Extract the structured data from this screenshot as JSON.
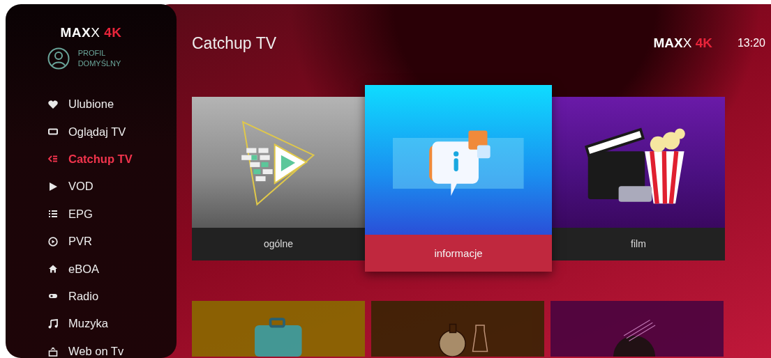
{
  "sidebar": {
    "logo": [
      {
        "text": "MAX",
        "kind": "bold"
      },
      {
        "text": "X",
        "kind": "light"
      },
      {
        "text": " 4K",
        "kind": "accent"
      }
    ],
    "profile": {
      "line1": "PROFIL",
      "line2": "DOMYŚLNY"
    },
    "items": [
      {
        "label": "Ulubione",
        "kind": "heart",
        "selected": false
      },
      {
        "label": "Oglądaj TV",
        "kind": "screen",
        "selected": false
      },
      {
        "label": "Catchup TV",
        "kind": "catchup",
        "selected": true
      },
      {
        "label": "VOD",
        "kind": "play",
        "selected": false
      },
      {
        "label": "EPG",
        "kind": "list",
        "selected": false
      },
      {
        "label": "PVR",
        "kind": "pvr",
        "selected": false
      },
      {
        "label": "eBOA",
        "kind": "home",
        "selected": false
      },
      {
        "label": "Radio",
        "kind": "radio",
        "selected": false
      },
      {
        "label": "Muzyka",
        "kind": "music",
        "selected": false
      },
      {
        "label": "Web on Tv",
        "kind": "web",
        "selected": false
      }
    ]
  },
  "header": {
    "title": "Catchup TV",
    "logo": [
      {
        "text": "MAX",
        "kind": "bold"
      },
      {
        "text": "X",
        "kind": "light"
      },
      {
        "text": " 4K",
        "kind": "accent"
      }
    ],
    "time": "13:20"
  },
  "cards": [
    {
      "label": "ogólne",
      "kind": "play",
      "selected": false
    },
    {
      "label": "informacje",
      "kind": "info",
      "selected": true
    },
    {
      "label": "film",
      "kind": "film",
      "selected": false
    },
    {
      "kind": "travel",
      "selected": false
    },
    {
      "kind": "science",
      "selected": false
    },
    {
      "kind": "music",
      "selected": false
    }
  ]
}
